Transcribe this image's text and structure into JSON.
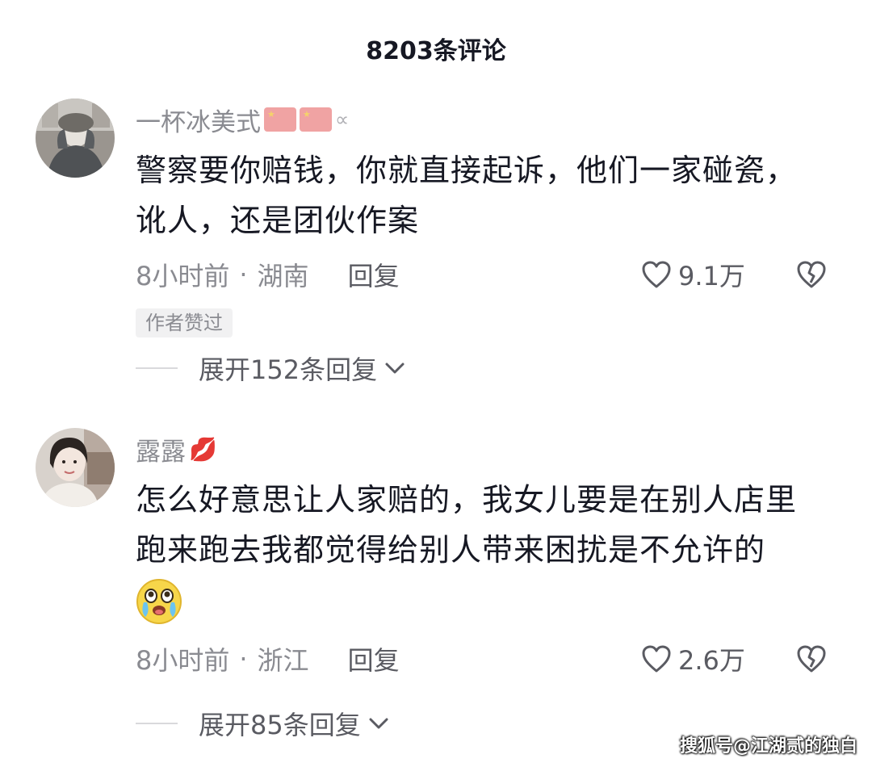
{
  "header": {
    "title": "8203条评论"
  },
  "comments": [
    {
      "username": "一杯冰美式",
      "username_tail": "∝",
      "text_lines": [
        "警察要你赔钱，你就直接起诉，他们一家碰瓷，",
        "讹人，还是团伙作案"
      ],
      "time": "8小时前",
      "dot": "·",
      "location": "湖南",
      "reply_label": "回复",
      "likes": "9.1万",
      "badge": "作者赞过",
      "expand_label": "展开152条回复"
    },
    {
      "username": "露露",
      "username_tail": "💋",
      "text_lines": [
        "怎么好意思让人家赔的，我女儿要是在别人店里",
        "跑来跑去我都觉得给别人带来困扰是不允许的"
      ],
      "time": "8小时前",
      "dot": "·",
      "location": "浙江",
      "reply_label": "回复",
      "likes": "2.6万",
      "expand_label": "展开85条回复"
    }
  ],
  "watermark": "搜狐号@江湖贰的独白",
  "icons": {
    "like": "heart-outline-icon",
    "dislike": "broken-heart-icon",
    "expand": "chevron-down-icon"
  },
  "colors": {
    "primary_text": "#161823",
    "secondary_text": "#8a8b91",
    "badge_bg": "#f1f1f2"
  }
}
